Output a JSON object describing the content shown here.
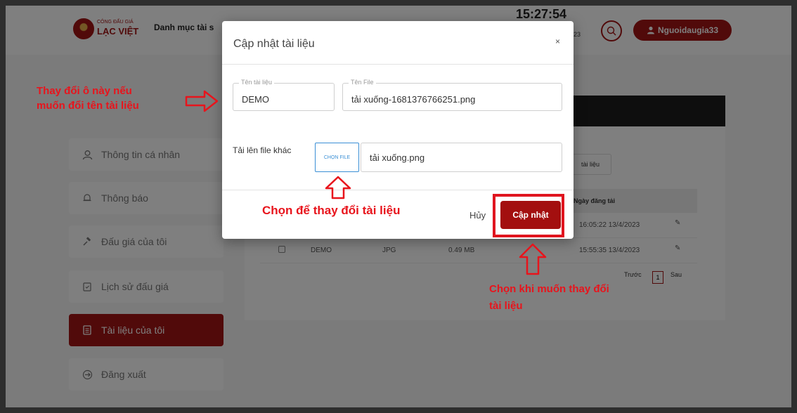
{
  "header": {
    "logo_top": "CÔNG ĐẤU GIÁ",
    "logo_bottom": "LẠC VIỆT",
    "nav_label": "Danh mục tài s",
    "clock": "15:27:54",
    "date": "23",
    "user": "Nguoidaugia33"
  },
  "sidebar": {
    "items": [
      {
        "label": "Thông tin cá nhân",
        "icon": "user-icon"
      },
      {
        "label": "Thông báo",
        "icon": "bell-icon"
      },
      {
        "label": "Đấu giá của tôi",
        "icon": "gavel-icon"
      },
      {
        "label": "Lịch sử đấu giá",
        "icon": "history-icon"
      },
      {
        "label": "Tài liệu của tôi",
        "icon": "document-icon",
        "active": true
      },
      {
        "label": "Đăng xuất",
        "icon": "logout-icon"
      }
    ]
  },
  "panel": {
    "add_button": "tài liệu",
    "col_date": "Ngày đăng tải",
    "rows": [
      {
        "date": "16:05:22 13/4/2023"
      },
      {
        "name": "DEMO",
        "type": "JPG",
        "size": "0.49 MB",
        "date": "15:55:35 13/4/2023"
      }
    ],
    "pager": {
      "prev": "Trước",
      "page": "1",
      "next": "Sau"
    }
  },
  "modal": {
    "title": "Cập nhật tài liệu",
    "close": "×",
    "name_legend": "Tên tài liệu",
    "name_value": "DEMO",
    "file_legend": "Tên File",
    "file_value": "tải xuống-1681376766251.png",
    "upload_label": "Tải lên file khác",
    "choose_button": "CHỌN FILE",
    "chosen_file": "tải xuống.png",
    "cancel": "Hủy",
    "confirm": "Cập nhật"
  },
  "annotations": {
    "rename_line1": "Thay đổi ô này nếu",
    "rename_line2": "muốn đổi tên tài liệu",
    "choose_hint": "Chọn để thay đổi tài liệu",
    "confirm_line1": "Chọn khi muốn thay đổi",
    "confirm_line2": "tài liệu"
  },
  "colors": {
    "brand": "#a31515",
    "annotation": "#e8141c",
    "link": "#3a8fd5"
  }
}
